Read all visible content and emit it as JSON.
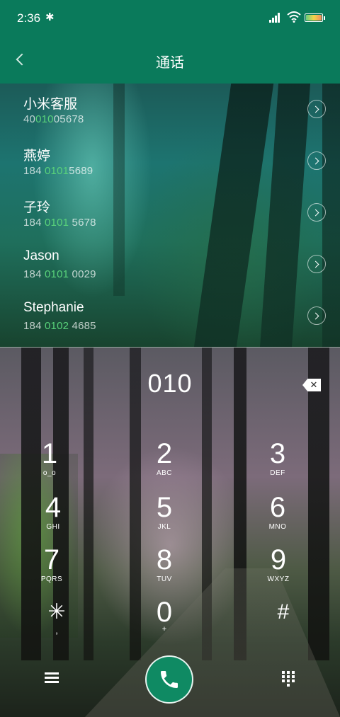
{
  "status_bar": {
    "time": "2:36"
  },
  "header": {
    "title": "通话"
  },
  "recent_calls": [
    {
      "name": "小米客服",
      "number_prefix": "40",
      "number_match": "010",
      "number_suffix": "05678"
    },
    {
      "name": "燕婷",
      "number_prefix": "184 ",
      "number_match": "0101",
      "number_suffix": "5689"
    },
    {
      "name": "子玲",
      "number_prefix": "184 ",
      "number_match": "0101",
      "number_suffix": " 5678"
    },
    {
      "name": "Jason",
      "number_prefix": "184 ",
      "number_match": "0101",
      "number_suffix": " 0029"
    },
    {
      "name": "Stephanie",
      "number_prefix": "184 ",
      "number_match": "0102",
      "number_suffix": " 4685"
    }
  ],
  "dialpad": {
    "input": "010",
    "keys": [
      {
        "digit": "1",
        "letters": "ᴏ_ᴏ"
      },
      {
        "digit": "2",
        "letters": "ABC"
      },
      {
        "digit": "3",
        "letters": "DEF"
      },
      {
        "digit": "4",
        "letters": "GHI"
      },
      {
        "digit": "5",
        "letters": "JKL"
      },
      {
        "digit": "6",
        "letters": "MNO"
      },
      {
        "digit": "7",
        "letters": "PQRS"
      },
      {
        "digit": "8",
        "letters": "TUV"
      },
      {
        "digit": "9",
        "letters": "WXYZ"
      },
      {
        "digit": "✳",
        "letters": ","
      },
      {
        "digit": "0",
        "letters": "+"
      },
      {
        "digit": "#",
        "letters": ""
      }
    ]
  },
  "colors": {
    "header_green": "#0a7a5b",
    "match_highlight": "#59d27a",
    "call_button": "#0f8a63"
  },
  "icons": {
    "back": "chevron-left-icon",
    "detail": "chevron-right-circle-icon",
    "backspace": "backspace-icon",
    "menu": "menu-icon",
    "call": "phone-icon",
    "keypad": "keypad-icon"
  }
}
